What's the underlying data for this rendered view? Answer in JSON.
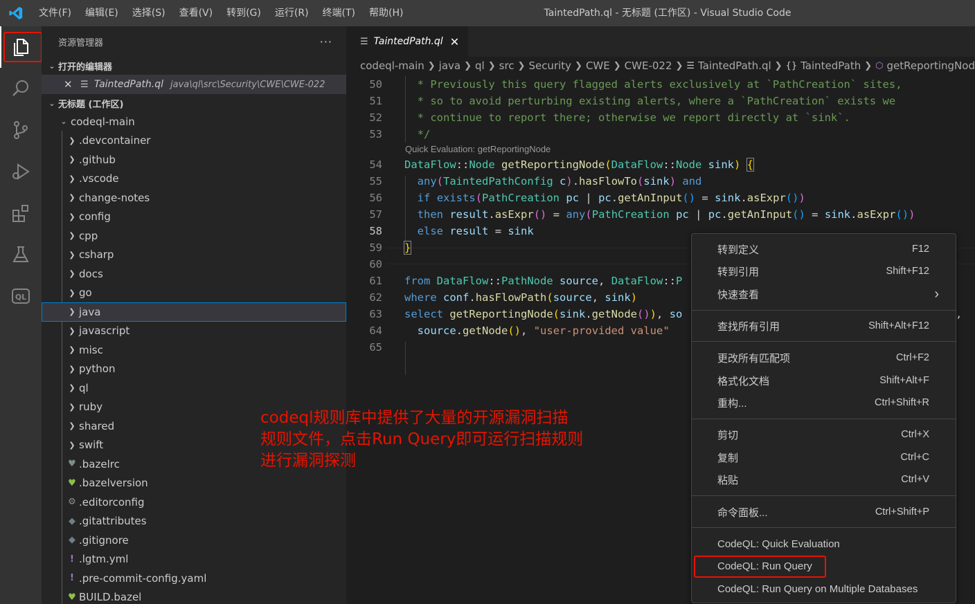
{
  "window": {
    "title": "TaintedPath.ql - 无标题 (工作区) - Visual Studio Code",
    "menu": [
      "文件(F)",
      "编辑(E)",
      "选择(S)",
      "查看(V)",
      "转到(G)",
      "运行(R)",
      "终端(T)",
      "帮助(H)"
    ]
  },
  "activity_bar": {
    "items": [
      "explorer-icon",
      "search-icon",
      "source-control-icon",
      "run-debug-icon",
      "extensions-icon",
      "testing-icon",
      "codeql-icon"
    ],
    "codeql_label": "QL"
  },
  "sidebar": {
    "header": "资源管理器",
    "more": "···",
    "open_editors_title": "打开的编辑器",
    "open_editor": {
      "name": "TaintedPath.ql",
      "path": "java\\ql\\src\\Security\\CWE\\CWE-022"
    },
    "workspace_title": "无标题 (工作区)",
    "root_folder": "codeql-main",
    "folders": [
      ".devcontainer",
      ".github",
      ".vscode",
      "change-notes",
      "config",
      "cpp",
      "csharp",
      "docs",
      "go",
      "java",
      "javascript",
      "misc",
      "python",
      "ql",
      "ruby",
      "shared",
      "swift"
    ],
    "selected_folder": "java",
    "files": [
      {
        "name": ".bazelrc",
        "icon": "bazel-icon"
      },
      {
        "name": ".bazelversion",
        "icon": "bazel-icon"
      },
      {
        "name": ".editorconfig",
        "icon": "gear-icon"
      },
      {
        "name": ".gitattributes",
        "icon": "git-icon"
      },
      {
        "name": ".gitignore",
        "icon": "git-icon"
      },
      {
        "name": ".lgtm.yml",
        "icon": "yaml-icon"
      },
      {
        "name": ".pre-commit-config.yaml",
        "icon": "yaml-icon"
      },
      {
        "name": "BUILD.bazel",
        "icon": "bazel-icon"
      }
    ]
  },
  "editor": {
    "tab": "TaintedPath.ql",
    "breadcrumb": [
      "codeql-main",
      "java",
      "ql",
      "src",
      "Security",
      "CWE",
      "CWE-022",
      "TaintedPath.ql",
      "TaintedPath",
      "getReportingNode"
    ],
    "codelens": "Quick Evaluation: getReportingNode",
    "line_numbers": [
      "50",
      "51",
      "52",
      "53",
      "54",
      "55",
      "56",
      "57",
      "58",
      "59",
      "60",
      "61",
      "62",
      "63",
      "64",
      "65"
    ],
    "current_line": "58",
    "overflow_comma": ","
  },
  "context_menu": {
    "items": [
      {
        "label": "转到定义",
        "shortcut": "F12"
      },
      {
        "label": "转到引用",
        "shortcut": "Shift+F12"
      },
      {
        "label": "快速查看",
        "shortcut": "›"
      },
      {
        "label": "查找所有引用",
        "shortcut": "Shift+Alt+F12"
      },
      {
        "label": "更改所有匹配项",
        "shortcut": "Ctrl+F2"
      },
      {
        "label": "格式化文档",
        "shortcut": "Shift+Alt+F"
      },
      {
        "label": "重构...",
        "shortcut": "Ctrl+Shift+R"
      },
      {
        "label": "剪切",
        "shortcut": "Ctrl+X"
      },
      {
        "label": "复制",
        "shortcut": "Ctrl+C"
      },
      {
        "label": "粘贴",
        "shortcut": "Ctrl+V"
      },
      {
        "label": "命令面板...",
        "shortcut": "Ctrl+Shift+P"
      },
      {
        "label": "CodeQL: Quick Evaluation",
        "shortcut": ""
      },
      {
        "label": "CodeQL: Run Query",
        "shortcut": ""
      },
      {
        "label": "CodeQL: Run Query on Multiple Databases",
        "shortcut": ""
      }
    ]
  },
  "annotation": {
    "lines": [
      "codeql规则库中提供了大量的开源漏洞扫描",
      "规则文件，点击Run Query即可运行扫描规则",
      "进行漏洞探测"
    ],
    "color": "#e51400"
  }
}
